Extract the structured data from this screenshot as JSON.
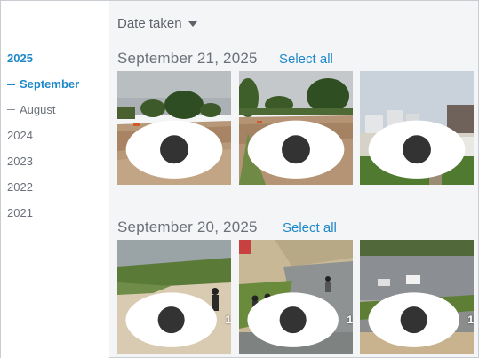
{
  "sidebar": {
    "year_2025": "2025",
    "month_september": "September",
    "month_august": "August",
    "year_2024": "2024",
    "year_2023": "2023",
    "year_2022": "2022",
    "year_2021": "2021"
  },
  "toolbar": {
    "sort_label": "Date taken"
  },
  "groups": [
    {
      "date": "September 21, 2025",
      "select_all": "Select all",
      "photos": [
        {
          "views": ""
        },
        {
          "views": ""
        },
        {
          "views": ""
        }
      ]
    },
    {
      "date": "September 20, 2025",
      "select_all": "Select all",
      "photos": [
        {
          "views": "1"
        },
        {
          "views": "1"
        },
        {
          "views": "1"
        }
      ]
    }
  ],
  "colors": {
    "accent": "#1e88c9",
    "muted_text": "#6b7079",
    "background": "#f4f5f7"
  },
  "icons": {
    "views": "eye-icon",
    "sort": "caret-down-icon"
  }
}
